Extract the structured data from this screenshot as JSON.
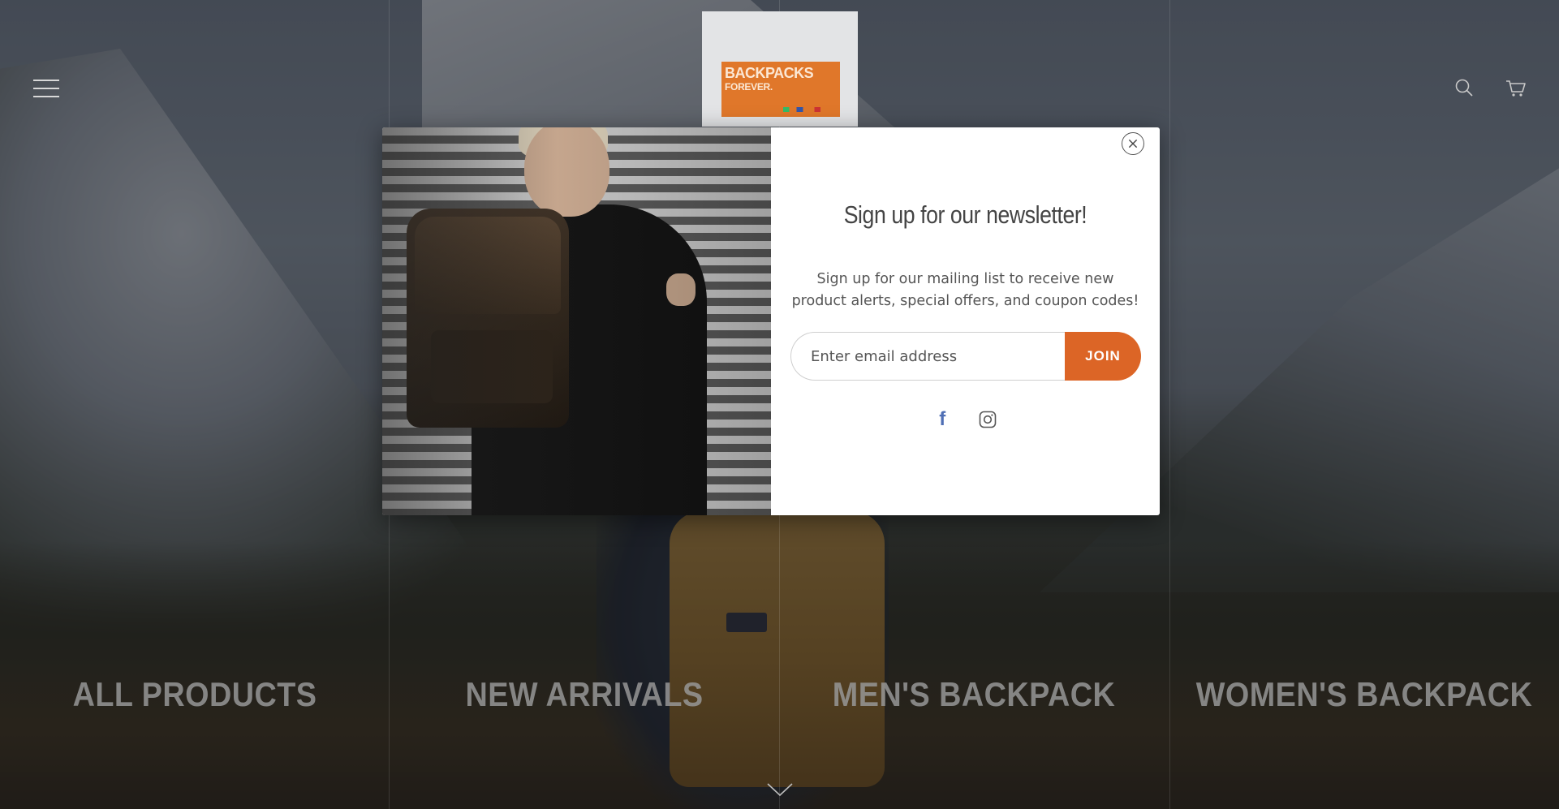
{
  "header": {
    "menu_icon": "hamburger-menu-icon",
    "logo": {
      "line1": "BACKPACKS",
      "line2": "FOREVER."
    },
    "search_icon": "search-icon",
    "cart_icon": "cart-icon"
  },
  "categories": [
    {
      "label": "ALL PRODUCTS"
    },
    {
      "label": "NEW ARRIVALS"
    },
    {
      "label": "MEN'S BACKPACK"
    },
    {
      "label": "WOMEN'S BACKPACK"
    }
  ],
  "popup": {
    "title": "Sign up for our newsletter!",
    "description": "Sign up for our mailing list to receive new product alerts, special offers, and coupon codes!",
    "email_placeholder": "Enter email address",
    "join_label": "JOIN",
    "facebook_glyph": "f",
    "social_icons": [
      "facebook-icon",
      "instagram-icon"
    ]
  },
  "colors": {
    "accent": "#dc6526",
    "logo_orange": "#e0772a",
    "facebook_blue": "#4f6fb5"
  }
}
